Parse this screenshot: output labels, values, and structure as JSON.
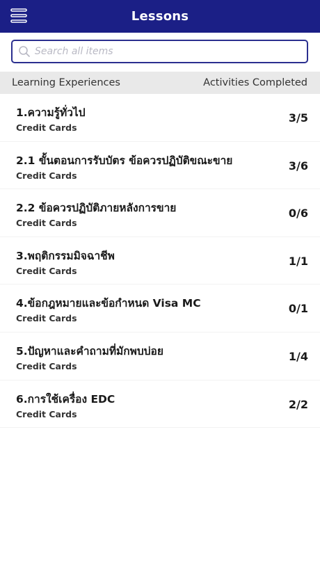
{
  "header": {
    "title": "Lessons",
    "menu_icon": "hamburger-menu-icon",
    "background": "#1b1f86"
  },
  "search": {
    "placeholder": "Search all items",
    "value": "",
    "icon": "search-icon"
  },
  "columns": {
    "left": "Learning Experiences",
    "right": "Activities Completed"
  },
  "lessons": [
    {
      "title": "1.ความรู้ทั่วไป",
      "category": "Credit Cards",
      "completed": "3/5"
    },
    {
      "title": "2.1 ขั้นตอนการรับบัตร ข้อควรปฏิบัติขณะขาย",
      "category": "Credit Cards",
      "completed": "3/6"
    },
    {
      "title": "2.2 ข้อควรปฏิบัติภายหลังการขาย",
      "category": "Credit Cards",
      "completed": "0/6"
    },
    {
      "title": "3.พฤติกรรมมิจฉาชีพ",
      "category": "Credit Cards",
      "completed": "1/1"
    },
    {
      "title": "4.ข้อกฎหมายและข้อกำหนด Visa MC",
      "category": "Credit Cards",
      "completed": "0/1"
    },
    {
      "title": "5.ปัญหาและคำถามที่มักพบบ่อย",
      "category": "Credit Cards",
      "completed": "1/4"
    },
    {
      "title": "6.การใช้เครื่อง EDC",
      "category": "Credit Cards",
      "completed": "2/2"
    }
  ]
}
